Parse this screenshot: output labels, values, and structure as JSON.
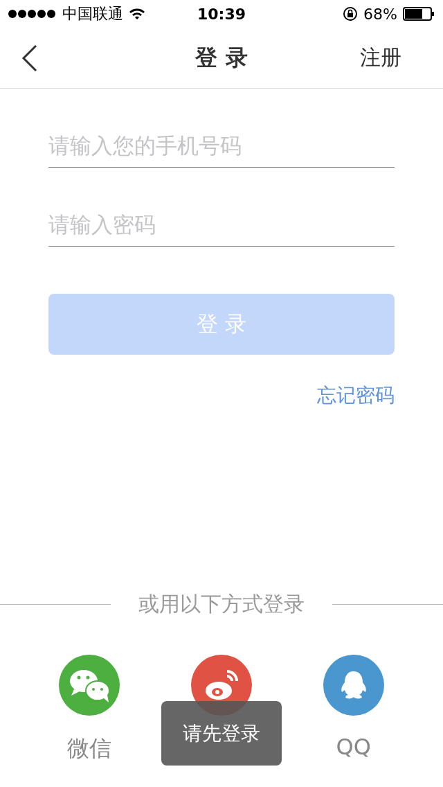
{
  "status_bar": {
    "carrier": "中国联通",
    "time": "10:39",
    "battery_text": "68%"
  },
  "nav": {
    "title": "登 录",
    "action": "注册"
  },
  "fields": [
    {
      "placeholder": "请输入您的手机号码"
    },
    {
      "placeholder": "请输入密码"
    }
  ],
  "login_button": {
    "label": "登 录",
    "disabled": true
  },
  "forgot_link": "忘记密码",
  "divider_text": "或用以下方式登录",
  "social": [
    {
      "kind": "wechat",
      "label": "微信",
      "color": "#4caf3f"
    },
    {
      "kind": "weibo",
      "color": "#e05244"
    },
    {
      "kind": "qq",
      "label": "QQ",
      "color": "#4a97cf"
    }
  ],
  "toast": "请先登录"
}
